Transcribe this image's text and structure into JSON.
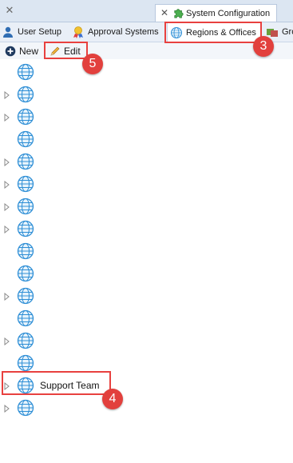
{
  "document_tabs": {
    "closed_tab_close_icon": "close-icon",
    "active_tab": {
      "label": "System Configuration",
      "icon": "puzzle-icon"
    }
  },
  "ribbon_tabs": [
    {
      "label": "User Setup",
      "icon": "user-icon"
    },
    {
      "label": "Approval Systems",
      "icon": "award-icon"
    },
    {
      "label": "Regions & Offices",
      "icon": "globe-icon",
      "selected": true
    },
    {
      "label": "Gro",
      "icon": "group-icon"
    }
  ],
  "toolbar": {
    "new_label": "New",
    "edit_label": "Edit"
  },
  "tree": {
    "rows": [
      {
        "label": "",
        "expandable": false
      },
      {
        "label": "",
        "expandable": true
      },
      {
        "label": "",
        "expandable": true
      },
      {
        "label": "",
        "expandable": false
      },
      {
        "label": "",
        "expandable": true
      },
      {
        "label": "",
        "expandable": true
      },
      {
        "label": "",
        "expandable": true
      },
      {
        "label": "",
        "expandable": true
      },
      {
        "label": "",
        "expandable": false
      },
      {
        "label": "",
        "expandable": false
      },
      {
        "label": "",
        "expandable": true
      },
      {
        "label": "",
        "expandable": false
      },
      {
        "label": "",
        "expandable": true
      },
      {
        "label": "",
        "expandable": false
      },
      {
        "label": "Support Team",
        "expandable": true,
        "selected": true
      },
      {
        "label": "",
        "expandable": true
      }
    ]
  },
  "callouts": {
    "badge_3": "3",
    "badge_4": "4",
    "badge_5": "5"
  },
  "colors": {
    "accent_highlight": "#e8413f",
    "globe": "#2f8fd6",
    "tab_strip": "#dce6f2"
  }
}
